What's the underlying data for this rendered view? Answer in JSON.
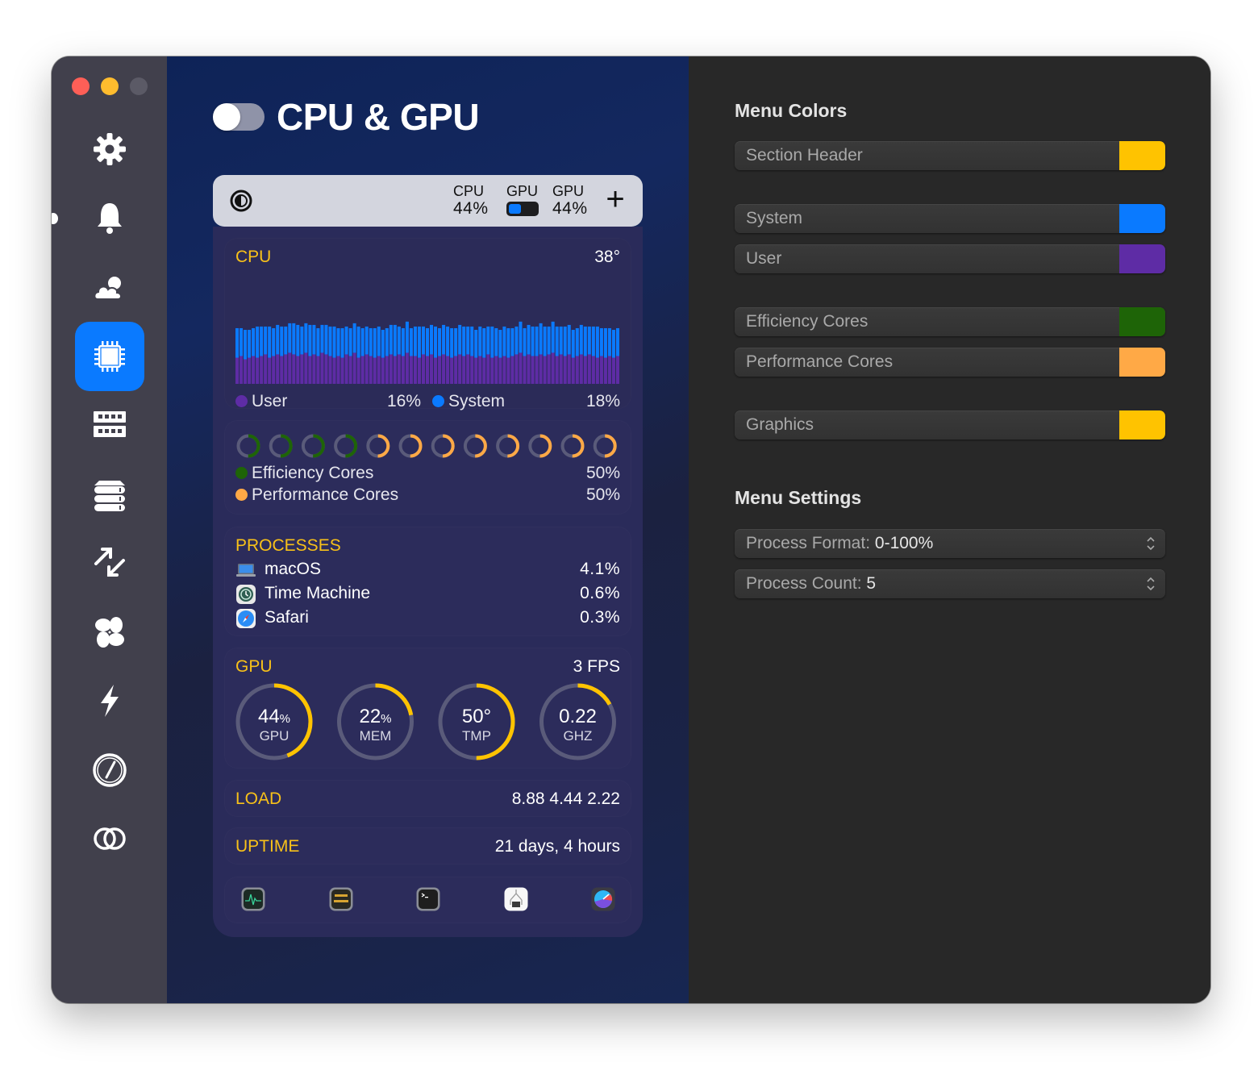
{
  "window": {
    "traffic_lights": [
      "close",
      "minimize",
      "zoom"
    ]
  },
  "sidebar": {
    "items": [
      {
        "icon": "gear-icon",
        "label": "Settings",
        "active": false
      },
      {
        "icon": "bell-icon",
        "label": "Notifications",
        "active": false
      },
      {
        "icon": "weather-icon",
        "label": "Weather",
        "active": false
      },
      {
        "icon": "cpu-chip-icon",
        "label": "CPU & GPU",
        "active": true
      },
      {
        "icon": "memory-icon",
        "label": "Memory",
        "active": false
      },
      {
        "icon": "disk-icon",
        "label": "Disk",
        "active": false
      },
      {
        "icon": "network-arrows-icon",
        "label": "Network",
        "active": false
      },
      {
        "icon": "fan-icon",
        "label": "Sensors",
        "active": false
      },
      {
        "icon": "bolt-icon",
        "label": "Battery",
        "active": false
      },
      {
        "icon": "clock-icon",
        "label": "Time",
        "active": false
      },
      {
        "icon": "bluetooth-rings-icon",
        "label": "Bluetooth",
        "active": false
      }
    ]
  },
  "header": {
    "title": "CPU & GPU",
    "enabled": false
  },
  "menubar_preview": {
    "cpu_label": "CPU",
    "cpu_value": "44%",
    "gpu_bar_label": "GPU",
    "gpu_bar_fraction": 0.44,
    "gpu_label": "GPU",
    "gpu_value": "44%",
    "add_label": "+"
  },
  "cpu": {
    "header": "CPU",
    "temperature": "38°",
    "user_label": "User",
    "user_value": "16%",
    "system_label": "System",
    "system_value": "18%"
  },
  "cores": {
    "efficiency_label": "Efficiency Cores",
    "efficiency_value": "50%",
    "performance_label": "Performance Cores",
    "performance_value": "50%",
    "rings": [
      {
        "type": "efficiency",
        "fraction": 0.5
      },
      {
        "type": "efficiency",
        "fraction": 0.5
      },
      {
        "type": "efficiency",
        "fraction": 0.5
      },
      {
        "type": "efficiency",
        "fraction": 0.5
      },
      {
        "type": "performance",
        "fraction": 0.5
      },
      {
        "type": "performance",
        "fraction": 0.5
      },
      {
        "type": "performance",
        "fraction": 0.5
      },
      {
        "type": "performance",
        "fraction": 0.5
      },
      {
        "type": "performance",
        "fraction": 0.5
      },
      {
        "type": "performance",
        "fraction": 0.5
      },
      {
        "type": "performance",
        "fraction": 0.5
      },
      {
        "type": "performance",
        "fraction": 0.5
      }
    ]
  },
  "processes": {
    "header": "PROCESSES",
    "items": [
      {
        "name": "macOS",
        "value": "4.1%",
        "icon": "laptop-icon"
      },
      {
        "name": "Time Machine",
        "value": "0.6%",
        "icon": "time-machine-icon"
      },
      {
        "name": "Safari",
        "value": "0.3%",
        "icon": "safari-icon"
      }
    ]
  },
  "gpu": {
    "header": "GPU",
    "fps": "3 FPS",
    "gauges": [
      {
        "value": "44",
        "unit": "%",
        "label": "GPU",
        "fraction": 0.44
      },
      {
        "value": "22",
        "unit": "%",
        "label": "MEM",
        "fraction": 0.22
      },
      {
        "value": "50°",
        "unit": "",
        "label": "TMP",
        "fraction": 0.5
      },
      {
        "value": "0.22",
        "unit": "",
        "label": "GHZ",
        "fraction": 0.17
      }
    ]
  },
  "load": {
    "label": "LOAD",
    "value": "8.88 4.44 2.22"
  },
  "uptime": {
    "label": "UPTIME",
    "value": "21 days, 4 hours"
  },
  "apps": [
    {
      "name": "Activity Monitor",
      "icon": "activity-monitor-icon"
    },
    {
      "name": "Console",
      "icon": "console-icon"
    },
    {
      "name": "Terminal",
      "icon": "terminal-icon"
    },
    {
      "name": "System Information",
      "icon": "system-information-icon"
    },
    {
      "name": "iStat Menus",
      "icon": "istat-icon"
    }
  ],
  "settings": {
    "menu_colors_title": "Menu Colors",
    "colors": [
      {
        "label": "Section Header",
        "color": "#ffc300"
      },
      {
        "label": "System",
        "color": "#0a7aff"
      },
      {
        "label": "User",
        "color": "#5e2ca5"
      },
      {
        "label": "Efficiency Cores",
        "color": "#1e6407"
      },
      {
        "label": "Performance Cores",
        "color": "#ffa946"
      },
      {
        "label": "Graphics",
        "color": "#ffc300"
      }
    ],
    "menu_settings_title": "Menu Settings",
    "process_format_label": "Process Format:",
    "process_format_value": "0-100%",
    "process_count_label": "Process Count:",
    "process_count_value": "5"
  },
  "chart_data": {
    "type": "bar",
    "title": "CPU",
    "stacked": true,
    "ylim": [
      0,
      100
    ],
    "series": [
      {
        "name": "User",
        "color": "#5e2ca5",
        "values": [
          16,
          17,
          15,
          16,
          17,
          16,
          17,
          18,
          16,
          17,
          18,
          17,
          18,
          19,
          18,
          17,
          18,
          19,
          17,
          18,
          17,
          19,
          18,
          17,
          16,
          17,
          16,
          18,
          17,
          19,
          16,
          17,
          18,
          17,
          16,
          17,
          16,
          17,
          18,
          17,
          18,
          17,
          19,
          17,
          17,
          16,
          18,
          17,
          18,
          16,
          17,
          18,
          17,
          16,
          17,
          18,
          17,
          18,
          17,
          16,
          17,
          16,
          18,
          16,
          17,
          16,
          17,
          16,
          17,
          18,
          19,
          17,
          18,
          17,
          17,
          18,
          17,
          18,
          19,
          17,
          18,
          17,
          18,
          16,
          17,
          18,
          17,
          18,
          17,
          16,
          17,
          16,
          17,
          16,
          17
        ]
      },
      {
        "name": "System",
        "color": "#0a7aff",
        "values": [
          18,
          17,
          18,
          17,
          17,
          19,
          18,
          17,
          19,
          17,
          18,
          18,
          17,
          18,
          19,
          19,
          17,
          18,
          19,
          18,
          17,
          17,
          18,
          18,
          19,
          17,
          18,
          17,
          17,
          18,
          19,
          17,
          17,
          17,
          18,
          18,
          17,
          17,
          18,
          19,
          17,
          17,
          19,
          17,
          18,
          19,
          17,
          17,
          18,
          19,
          17,
          18,
          18,
          18,
          17,
          18,
          18,
          17,
          18,
          17,
          18,
          18,
          17,
          19,
          17,
          17,
          18,
          18,
          17,
          17,
          19,
          17,
          18,
          18,
          18,
          19,
          18,
          17,
          19,
          18,
          17,
          18,
          18,
          17,
          17,
          18,
          18,
          17,
          18,
          19,
          17,
          18,
          17,
          17,
          17
        ]
      }
    ]
  }
}
